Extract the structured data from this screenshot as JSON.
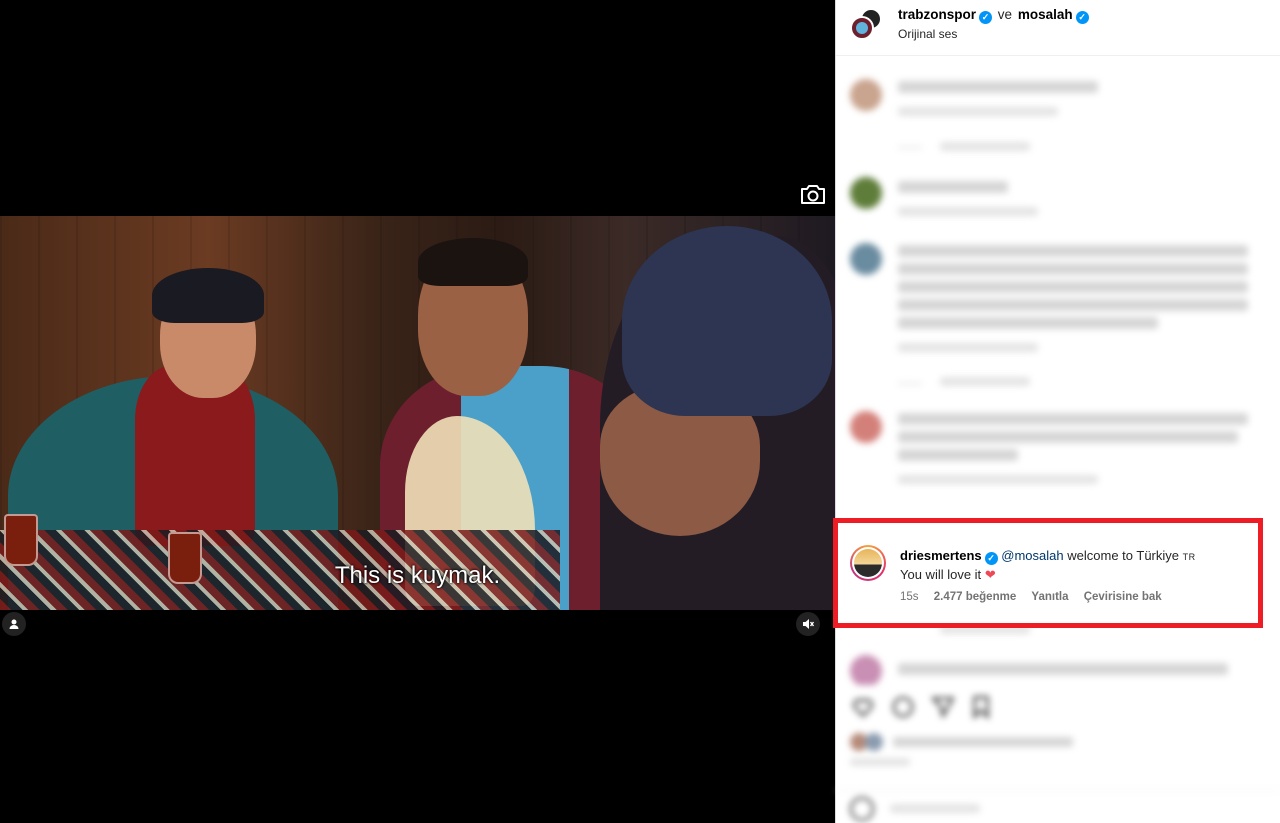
{
  "video": {
    "subtitle": "This is kuymak."
  },
  "header": {
    "user1": "trabzonspor",
    "connector": "ve",
    "user2": "mosalah",
    "audio": "Orijinal ses"
  },
  "highlighted_comment": {
    "username": "driesmertens",
    "mention": "@mosalah",
    "text1": "welcome to Türkiye",
    "flag": "TR",
    "text2": "You will love it",
    "heart": "❤",
    "time": "15s",
    "likes": "2.477 beğenme",
    "reply": "Yanıtla",
    "translate": "Çevirisine bak"
  },
  "colors": {
    "highlight_border": "#ee1c24",
    "verified": "#0095f6",
    "heart": "#ed4956"
  },
  "icons": [
    "camera-icon",
    "profile-icon",
    "mute-icon",
    "verified-icon",
    "heart-icon",
    "comment-icon",
    "share-icon",
    "save-icon"
  ]
}
